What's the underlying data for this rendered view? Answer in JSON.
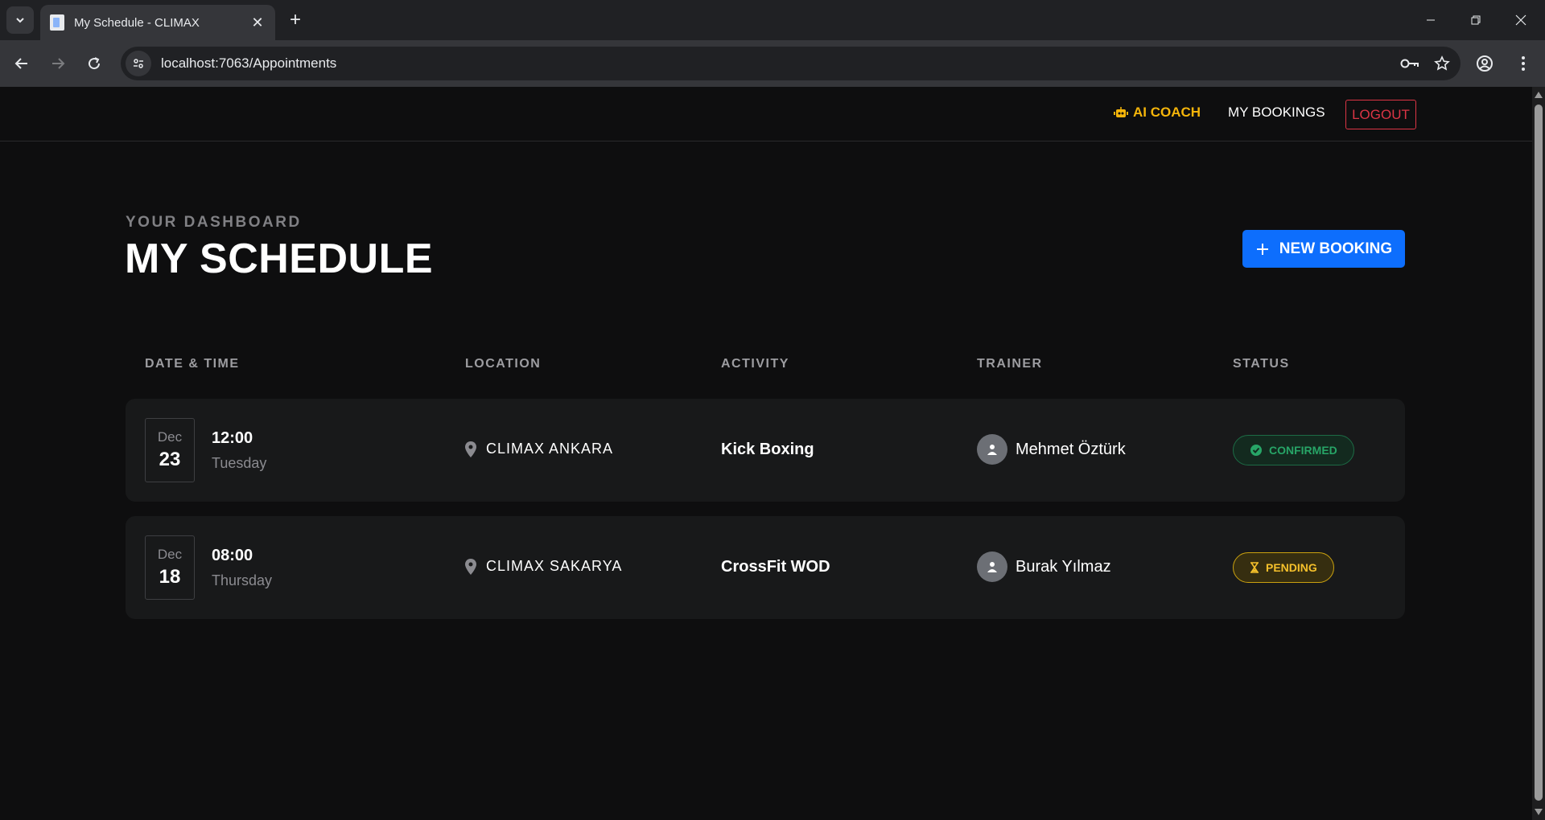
{
  "browser": {
    "tab_title": "My Schedule - CLIMAX",
    "url": "localhost:7063/Appointments"
  },
  "nav": {
    "ai_coach": "AI COACH",
    "my_bookings": "MY BOOKINGS",
    "logout": "LOGOUT"
  },
  "header": {
    "eyebrow": "YOUR DASHBOARD",
    "title": "MY SCHEDULE",
    "new_booking": "NEW BOOKING"
  },
  "columns": [
    "DATE & TIME",
    "LOCATION",
    "ACTIVITY",
    "TRAINER",
    "STATUS"
  ],
  "appointments": [
    {
      "month": "Dec",
      "day": "23",
      "time": "12:00",
      "weekday": "Tuesday",
      "location": "CLIMAX ANKARA",
      "activity": "Kick Boxing",
      "trainer": "Mehmet Öztürk",
      "status": "CONFIRMED",
      "status_icon": "check-circle-icon"
    },
    {
      "month": "Dec",
      "day": "18",
      "time": "08:00",
      "weekday": "Thursday",
      "location": "CLIMAX SAKARYA",
      "activity": "CrossFit WOD",
      "trainer": "Burak Yılmaz",
      "status": "PENDING",
      "status_icon": "hourglass-icon"
    }
  ],
  "colors": {
    "accent_blue": "#0d6efd",
    "ai_gold": "#f5b50a",
    "logout_red": "#dc3545",
    "confirmed_green": "#27a567",
    "pending_yellow": "#f5c02b"
  }
}
